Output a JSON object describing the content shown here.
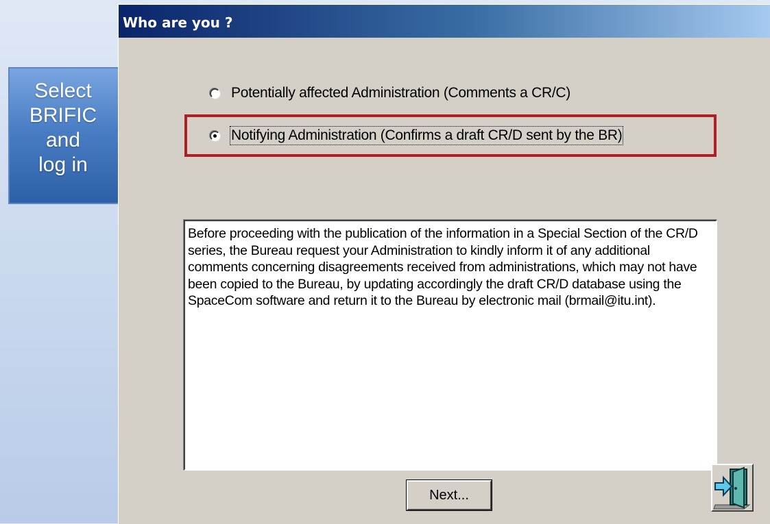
{
  "dialog": {
    "title": "Who are you ?",
    "options": [
      {
        "label": "Potentially affected Administration (Comments a CR/C)",
        "selected": false
      },
      {
        "label": "Notifying Administration (Confirms a draft CR/D sent by the BR)",
        "selected": true
      }
    ],
    "info_text": "Before proceeding with the publication of the information in a Special Section of the CR/D series, the Bureau request your Administration to kindly inform it of any additional comments concerning disagreements received from administrations, which may not have been copied to the Bureau, by updating accordingly the draft CR/D database using the SpaceCom software and return it to the Bureau by electronic mail (brmail@itu.int).",
    "next_label": "Next...",
    "exit_icon": "exit-door-icon"
  },
  "callout": {
    "lines": [
      "Select",
      "BRIFIC",
      "and",
      "log in"
    ],
    "color": "#4a7ec4"
  },
  "highlight_color": "#b11f24"
}
